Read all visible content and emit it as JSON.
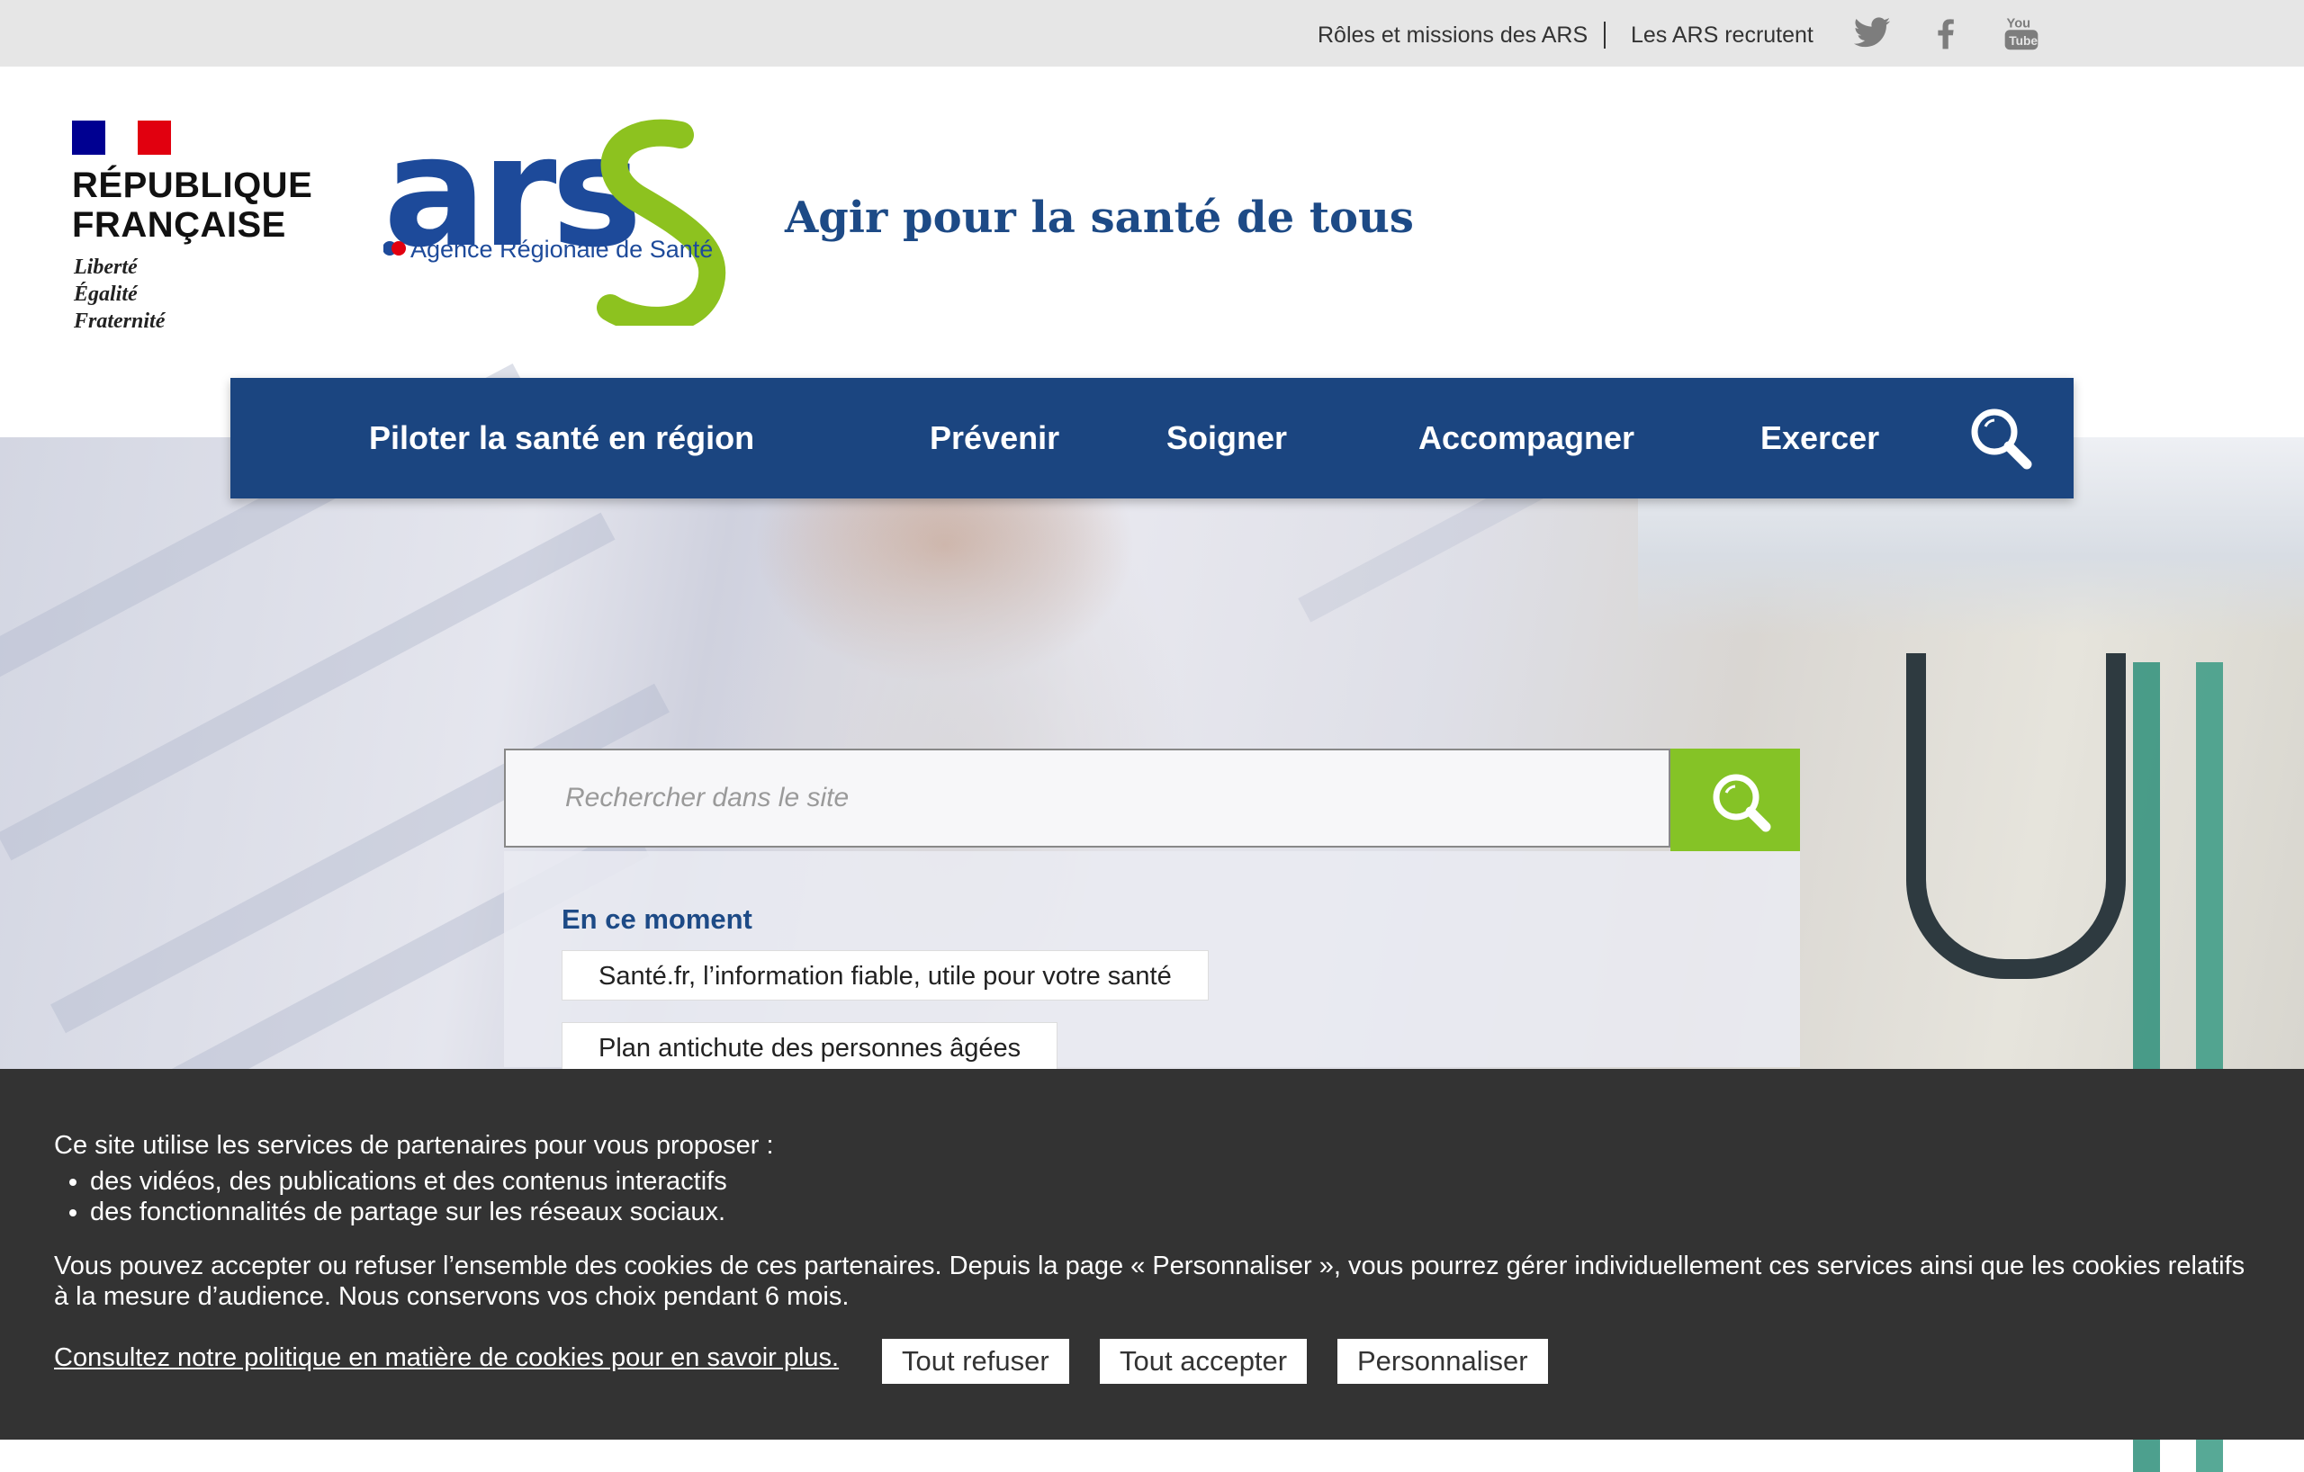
{
  "topbar": {
    "roles_link": "Rôles et missions des ARS",
    "recruit_link": "Les ARS recrutent",
    "social": [
      "twitter-icon",
      "facebook-icon",
      "youtube-icon"
    ]
  },
  "header": {
    "republique": {
      "name_line1": "RÉPUBLIQUE",
      "name_line2": "FRANÇAISE",
      "motto_line1": "Liberté",
      "motto_line2": "Égalité",
      "motto_line3": "Fraternité"
    },
    "ars_logo": {
      "text": "ars",
      "subtitle": "Agence Régionale de Santé"
    },
    "tagline": "Agir pour la santé de tous"
  },
  "nav": {
    "items": [
      "Piloter la santé en région",
      "Prévenir",
      "Soigner",
      "Accompagner",
      "Exercer"
    ],
    "search_icon": "search-icon"
  },
  "search": {
    "placeholder": "Rechercher dans le site",
    "button_icon": "search-icon"
  },
  "moment": {
    "title": "En ce moment",
    "links": [
      "Santé.fr, l’information fiable, utile pour votre santé",
      "Plan antichute des personnes âgées"
    ]
  },
  "cookie": {
    "intro": "Ce site utilise les services de partenaires pour vous proposer :",
    "bullets": [
      "des vidéos, des publications et des contenus interactifs",
      "des fonctionnalités de partage sur les réseaux sociaux."
    ],
    "paragraph": "Vous pouvez accepter ou refuser l’ensemble des cookies de ces partenaires. Depuis la page « Personnaliser », vous pourrez gérer individuellement ces services ainsi que les cookies relatifs à la mesure d’audience. Nous conservons vos choix pendant 6 mois.",
    "policy_link": "Consultez notre politique en matière de cookies pour en savoir plus.",
    "refuse": "Tout refuser",
    "accept": "Tout accepter",
    "customize": "Personnaliser"
  },
  "colors": {
    "navy": "#1b4580",
    "green": "#85c326",
    "cookie_bg": "#333333",
    "topbar_bg": "#e6e6e6"
  }
}
